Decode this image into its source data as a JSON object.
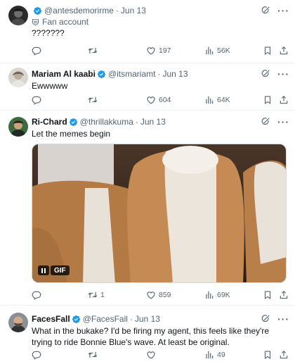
{
  "tweets": [
    {
      "handle": "@antesdemorirme",
      "time": "Jun 13",
      "fan_label": "Fan account",
      "text": "???????",
      "replies": "",
      "reposts": "",
      "likes": "197",
      "views": "56K"
    },
    {
      "name": "Mariam Al kaabi",
      "handle": "@itsmariamt",
      "time": "Jun 13",
      "text": "Ewwwww",
      "replies": "",
      "reposts": "",
      "likes": "604",
      "views": "64K"
    },
    {
      "name": "Ri-Chard",
      "handle": "@thrillakkuma",
      "time": "Jun 13",
      "text": "Let the memes begin",
      "media_badge": "GIF",
      "replies": "",
      "reposts": "1",
      "likes": "859",
      "views": "69K"
    },
    {
      "name": "FacesFall",
      "handle": "@FacesFall",
      "time": "Jun 13",
      "text": "What in the bukake? I'd be firing my agent, this feels like they're trying to ride Bonnie Blue's wave. At least be original.",
      "replies": "",
      "reposts": "",
      "likes": "",
      "views": "49"
    }
  ],
  "separator": "·",
  "colors": {
    "verified": "#1d9bf0",
    "text": "#0f1419",
    "secondary": "#536471",
    "divider": "#eff3f4"
  },
  "icons": [
    "verified-badge-icon",
    "fan-account-shield-icon",
    "grok-icon",
    "more-icon",
    "reply-icon",
    "repost-icon",
    "like-icon",
    "views-icon",
    "bookmark-icon",
    "share-icon",
    "pause-icon"
  ]
}
